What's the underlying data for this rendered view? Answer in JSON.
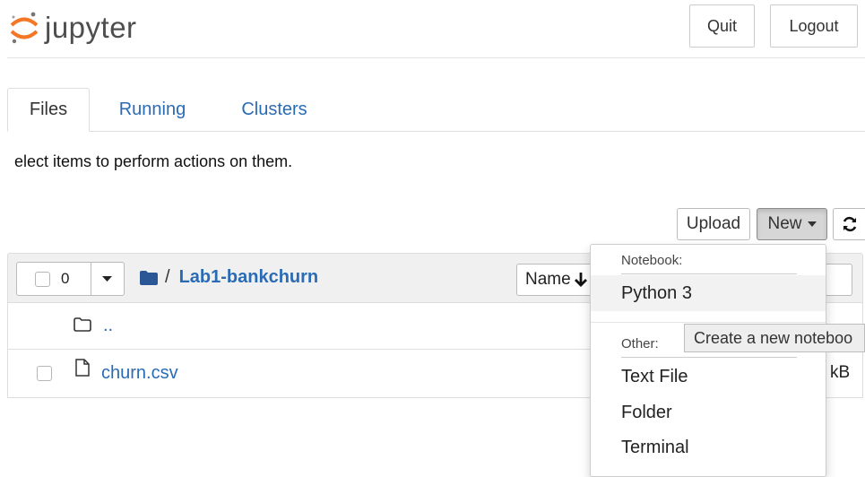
{
  "header": {
    "logo_text": "jupyter",
    "quit_label": "Quit",
    "logout_label": "Logout"
  },
  "tabs": [
    {
      "label": "Files",
      "active": true
    },
    {
      "label": "Running",
      "active": false
    },
    {
      "label": "Clusters",
      "active": false
    }
  ],
  "instructions": "elect items to perform actions on them.",
  "toolbar": {
    "upload_label": "Upload",
    "new_label": "New"
  },
  "list_header": {
    "selected_count": "0",
    "breadcrumb_separator": "/",
    "folder_name": "Lab1-bankchurn",
    "sort_label": "Name"
  },
  "rows": [
    {
      "name": "..",
      "type": "parent"
    },
    {
      "name": "churn.csv",
      "type": "file",
      "size_fragment": "kB"
    }
  ],
  "new_menu": {
    "notebook_header": "Notebook:",
    "notebook_items": [
      "Python 3"
    ],
    "other_header": "Other:",
    "other_items": [
      "Text File",
      "Folder",
      "Terminal"
    ],
    "tooltip": "Create a new noteboo"
  },
  "colors": {
    "link": "#2a6bb5",
    "logo_orange": "#f37726",
    "folder": "#2b5797"
  },
  "icons": {
    "logo": "jupyter-logo-icon",
    "folder": "folder-icon",
    "parent_folder": "folder-outline-icon",
    "file": "file-icon",
    "sort_arrow": "arrow-down-icon",
    "caret": "caret-down-icon",
    "refresh": "refresh-icon"
  }
}
